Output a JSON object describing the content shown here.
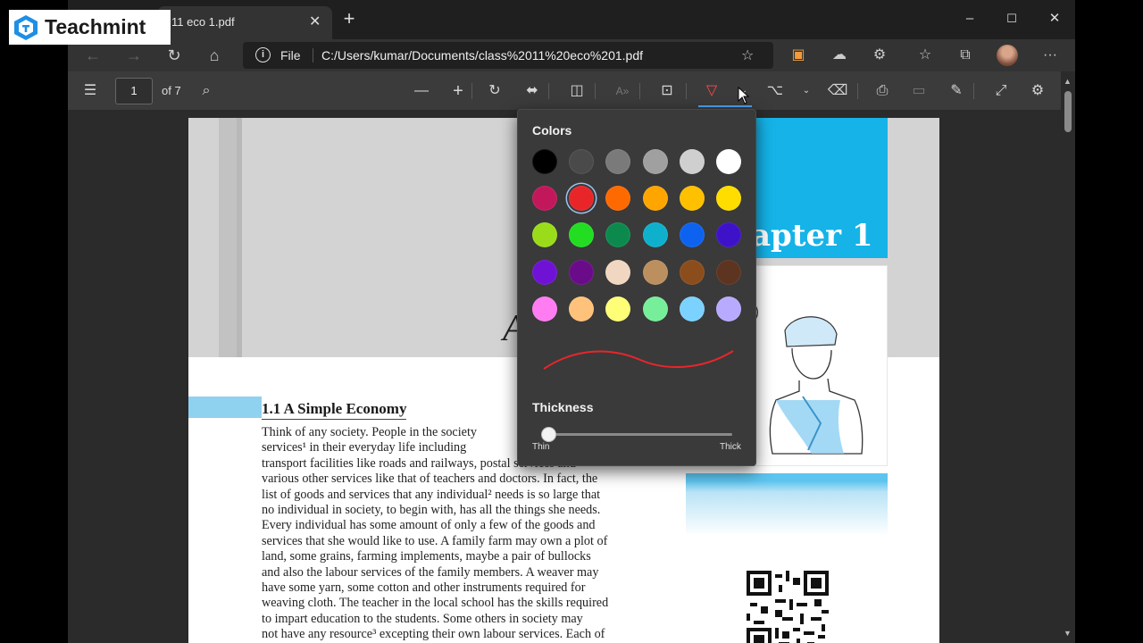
{
  "browser": {
    "tab": {
      "title": "11 eco 1.pdf"
    },
    "window_controls": {
      "minimize": "–",
      "maximize": "☐",
      "close": "✕"
    },
    "address": {
      "scheme_label": "File",
      "url": "C:/Users/kumar/Documents/class%2011%20eco%201.pdf"
    }
  },
  "pdf_toolbar": {
    "page_current": "1",
    "page_total_label": "of 7"
  },
  "document": {
    "hero_letter": "A",
    "chapter_label": "apter 1",
    "section_title": "1.1 A Simple Economy",
    "paragraph_lines": [
      "Think of any society. People in the society",
      "services¹ in their everyday life including",
      "transport facilities like roads and railways, postal services and",
      "various other services like that of teachers and doctors. In fact, the",
      "list of goods and services that any individual² needs is so large that",
      "no individual in society, to begin with, has all the things she needs.",
      "Every individual has some amount of only a few of the goods and",
      "services that she would like to use. A family farm may own a plot of",
      "land, some grains, farming implements, maybe a pair of bullocks",
      "and also the labour services of the family members. A weaver may",
      "have some yarn, some cotton and other instruments required for",
      "weaving cloth. The teacher in the local school has the skills required",
      "to impart education to the students. Some others in society may",
      "not have any resource³ excepting their own labour services. Each of"
    ]
  },
  "color_popup": {
    "colors_title": "Colors",
    "thickness_title": "Thickness",
    "thin_label": "Thin",
    "thick_label": "Thick",
    "selected_color": "#e8262a",
    "thickness_level": 0,
    "swatches": [
      [
        "#000000",
        "#4a4a4a",
        "#7a7a7a",
        "#a0a0a0",
        "#cfcfcf",
        "#ffffff"
      ],
      [
        "#c2185b",
        "#e8262a",
        "#ff6a00",
        "#ffa500",
        "#ffc000",
        "#ffdd00"
      ],
      [
        "#9bdc1a",
        "#22dd22",
        "#0c8a4e",
        "#0fb0cc",
        "#0d63f0",
        "#3d12c8"
      ],
      [
        "#6f12d6",
        "#6a0c8a",
        "#f1d7c1",
        "#bc8f5f",
        "#8b4d1c",
        "#5c3420"
      ],
      [
        "#ff7cf2",
        "#ffc27a",
        "#ffff77",
        "#77ee99",
        "#7cd2ff",
        "#b8aaff"
      ]
    ]
  },
  "watermark": {
    "brand": "Teachmint"
  }
}
